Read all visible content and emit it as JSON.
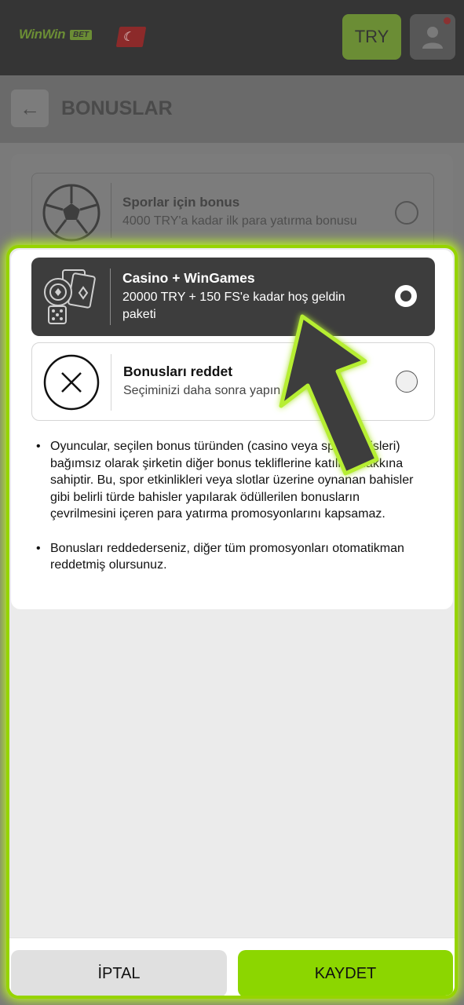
{
  "header": {
    "logo_text": "WinWin",
    "logo_badge": "BET",
    "currency": "TRY",
    "colors": {
      "bg": "#353535",
      "accent": "#6b8d35"
    }
  },
  "titlebar": {
    "back_icon": "arrow-left-icon",
    "title": "BONUSLAR"
  },
  "background_card": {
    "title": "Sporlar için bonus",
    "description": "4000 TRY'a kadar ilk para yatırma bonusu",
    "icon": "soccer-ball-icon"
  },
  "options": [
    {
      "title": "Casino + WinGames",
      "description": "20000 TRY + 150 FS'e kadar hoş geldin paketi",
      "icon": "casino-chips-cards-dice-icon",
      "selected": true
    },
    {
      "title": "Bonusları reddet",
      "description": "Seçiminizi daha sonra yapın",
      "icon": "close-circle-icon",
      "selected": false
    }
  ],
  "rules": [
    "Oyuncular, seçilen bonus türünden (casino veya spor bahisleri) bağımsız olarak şirketin diğer bonus tekliflerine katılma hakkına sahiptir. Bu, spor etkinlikleri veya slotlar üzerine oynanan bahisler gibi belirli türde bahisler yapılarak ödüllerilen bonusların çevrilmesini içeren para yatırma promosyonlarını kapsamaz.",
    "Bonusları reddederseniz, diğer tüm promosyonları otomatikman reddetmiş olursunuz."
  ],
  "footer": {
    "cancel_label": "İPTAL",
    "save_label": "KAYDET"
  },
  "colors": {
    "highlight": "#96d400",
    "save": "#8cd600",
    "option_selected_bg": "#3d3d3d"
  }
}
